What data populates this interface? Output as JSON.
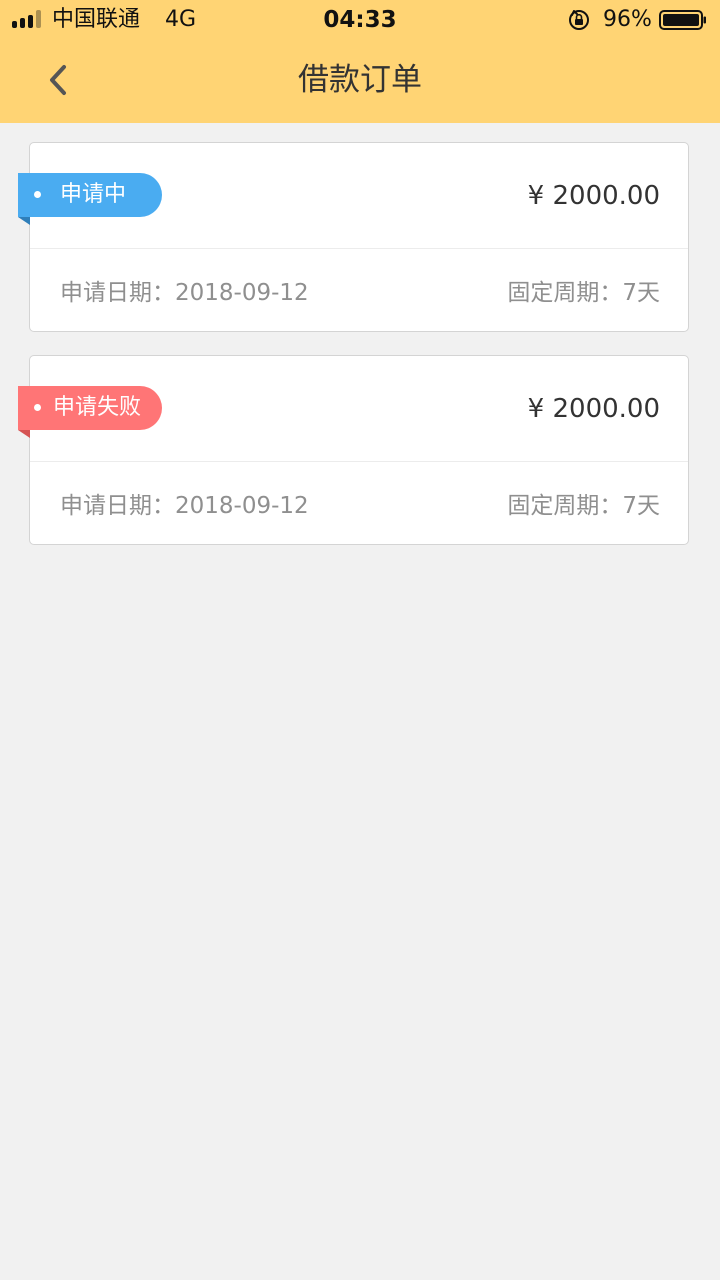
{
  "status_bar": {
    "carrier": "中国联通",
    "network": "4G",
    "time": "04:33",
    "battery_percent": "96%",
    "icons": [
      "signal-icon",
      "orientation-lock-icon",
      "battery-icon"
    ]
  },
  "nav": {
    "title": "借款订单",
    "back_icon": "chevron-left-icon"
  },
  "orders": [
    {
      "status": "申请中",
      "status_color": "#4aacf1",
      "amount": "¥ 2000.00",
      "date_text": "申请日期：2018-09-12",
      "period_text": "固定周期：7天"
    },
    {
      "status": "申请失败",
      "status_color": "#ff7576",
      "amount": "¥ 2000.00",
      "date_text": "申请日期：2018-09-12",
      "period_text": "固定周期：7天"
    }
  ],
  "colors": {
    "header_bg": "#ffd474",
    "page_bg": "#f1f1f1",
    "text_primary": "#333333",
    "text_secondary": "#8f8f8f"
  }
}
